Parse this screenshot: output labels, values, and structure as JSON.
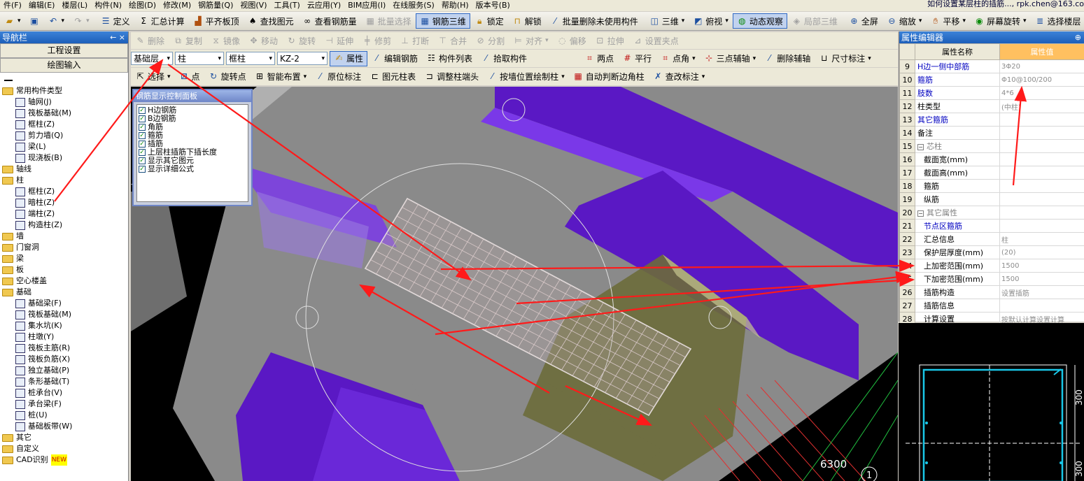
{
  "menu": {
    "items": [
      "件(F)",
      "编辑(E)",
      "楼层(L)",
      "构件(N)",
      "绘图(D)",
      "修改(M)",
      "钢筋量(Q)",
      "视图(V)",
      "工具(T)",
      "云应用(Y)",
      "BIM应用(I)",
      "在线服务(S)",
      "帮助(H)",
      "版本号(B)"
    ],
    "title_note": "如何设置某层柱的插筋..., rpk.chen@163.co"
  },
  "toolbar1": {
    "define": "定义",
    "sum": "汇总计算",
    "flat_top": "平齐板顶",
    "find": "查找图元",
    "view_rebar": "查看钢筋量",
    "batch_select": "批量选择",
    "rebar3d": "钢筋三维",
    "lock": "锁定",
    "unlock": "解锁",
    "batch_delete": "批量删除未使用构件",
    "view3d": "三维",
    "top_view": "俯视",
    "dynamic": "动态观察",
    "local3d": "局部三维",
    "fullscreen": "全屏",
    "zoom": "缩放",
    "pan": "平移",
    "rotate": "屏幕旋转",
    "select_floor": "选择楼层"
  },
  "draw_toolbar": {
    "delete": "删除",
    "copy": "复制",
    "mirror": "镜像",
    "move": "移动",
    "rotate": "旋转",
    "extend": "延伸",
    "trim": "修剪",
    "break": "打断",
    "merge": "合并",
    "split": "分割",
    "align": "对齐",
    "offset": "偏移",
    "stretch": "拉伸",
    "set_pin": "设置夹点"
  },
  "toolbar2": {
    "floor": "基础层",
    "type": "柱",
    "subtype": "框柱",
    "component": "KZ-2",
    "properties": "属性",
    "edit_rebar": "编辑钢筋",
    "component_list": "构件列表",
    "pick": "拾取构件",
    "two_point": "两点",
    "parallel": "平行",
    "point_angle": "点角",
    "three_point_axis": "三点辅轴",
    "delete_axis": "删除辅轴",
    "dimension": "尺寸标注"
  },
  "toolbar3": {
    "select": "选择",
    "point": "点",
    "rotate_point": "旋转点",
    "smart_layout": "智能布置",
    "origin_label": "原位标注",
    "column_table": "图元柱表",
    "adjust_end": "调整柱端头",
    "wall_draw": "按墙位置绘制柱",
    "auto_corner": "自动判断边角柱",
    "check_label": "查改标注"
  },
  "nav": {
    "title": "导航栏",
    "pin": "← ×",
    "project_settings": "工程设置",
    "drawing_input": "绘图输入",
    "tree": [
      {
        "type": "folder",
        "label": "常用构件类型"
      },
      {
        "type": "leaf",
        "label": "轴网(J)"
      },
      {
        "type": "leaf",
        "label": "筏板基础(M)"
      },
      {
        "type": "leaf",
        "label": "框柱(Z)"
      },
      {
        "type": "leaf",
        "label": "剪力墙(Q)"
      },
      {
        "type": "leaf",
        "label": "梁(L)"
      },
      {
        "type": "leaf",
        "label": "现浇板(B)"
      },
      {
        "type": "folder",
        "label": "轴线"
      },
      {
        "type": "folder",
        "label": "柱"
      },
      {
        "type": "leaf",
        "label": "框柱(Z)"
      },
      {
        "type": "leaf",
        "label": "暗柱(Z)"
      },
      {
        "type": "leaf",
        "label": "端柱(Z)"
      },
      {
        "type": "leaf",
        "label": "构造柱(Z)"
      },
      {
        "type": "folder",
        "label": "墙"
      },
      {
        "type": "folder",
        "label": "门窗洞"
      },
      {
        "type": "folder",
        "label": "梁"
      },
      {
        "type": "folder",
        "label": "板"
      },
      {
        "type": "folder",
        "label": "空心楼盖"
      },
      {
        "type": "folder",
        "label": "基础"
      },
      {
        "type": "leaf",
        "label": "基础梁(F)"
      },
      {
        "type": "leaf",
        "label": "筏板基础(M)"
      },
      {
        "type": "leaf",
        "label": "集水坑(K)"
      },
      {
        "type": "leaf",
        "label": "柱墩(Y)"
      },
      {
        "type": "leaf",
        "label": "筏板主筋(R)"
      },
      {
        "type": "leaf",
        "label": "筏板负筋(X)"
      },
      {
        "type": "leaf",
        "label": "独立基础(P)"
      },
      {
        "type": "leaf",
        "label": "条形基础(T)"
      },
      {
        "type": "leaf",
        "label": "桩承台(V)"
      },
      {
        "type": "leaf",
        "label": "承台梁(F)"
      },
      {
        "type": "leaf",
        "label": "桩(U)"
      },
      {
        "type": "leaf",
        "label": "基础板带(W)"
      },
      {
        "type": "folder",
        "label": "其它"
      },
      {
        "type": "folder",
        "label": "自定义"
      },
      {
        "type": "folder",
        "label": "CAD识别"
      }
    ],
    "new_badge": "NEW"
  },
  "control_panel": {
    "title": "钢筋显示控制面板",
    "items": [
      "H边钢筋",
      "B边钢筋",
      "角筋",
      "箍筋",
      "插筋",
      "上层柱插筋下插长度",
      "显示其它图元",
      "显示详细公式"
    ]
  },
  "properties": {
    "title": "属性编辑器",
    "col_name": "属性名称",
    "col_value": "属性值",
    "rows": [
      {
        "n": "9",
        "name": "H边一侧中部筋",
        "val": "3Φ20",
        "blue": true
      },
      {
        "n": "10",
        "name": "箍筋",
        "val": "Φ10@100/200",
        "blue": true
      },
      {
        "n": "11",
        "name": "肢数",
        "val": "4*6",
        "blue": true
      },
      {
        "n": "12",
        "name": "柱类型",
        "val": "(中柱)"
      },
      {
        "n": "13",
        "name": "其它箍筋",
        "val": "",
        "blue": true
      },
      {
        "n": "14",
        "name": "备注",
        "val": ""
      },
      {
        "n": "15",
        "name": "芯柱",
        "val": "",
        "group": true
      },
      {
        "n": "16",
        "name": "截面宽(mm)",
        "val": "",
        "child": true
      },
      {
        "n": "17",
        "name": "截面高(mm)",
        "val": "",
        "child": true
      },
      {
        "n": "18",
        "name": "箍筋",
        "val": "",
        "child": true
      },
      {
        "n": "19",
        "name": "纵筋",
        "val": "",
        "child": true
      },
      {
        "n": "20",
        "name": "其它属性",
        "val": "",
        "group": true
      },
      {
        "n": "21",
        "name": "节点区箍筋",
        "val": "",
        "child": true,
        "blue": true
      },
      {
        "n": "22",
        "name": "汇总信息",
        "val": "柱",
        "child": true
      },
      {
        "n": "23",
        "name": "保护层厚度(mm)",
        "val": "(20)",
        "child": true
      },
      {
        "n": "24",
        "name": "上加密范围(mm)",
        "val": "1500",
        "child": true
      },
      {
        "n": "25",
        "name": "下加密范围(mm)",
        "val": "1500",
        "child": true
      },
      {
        "n": "26",
        "name": "插筋构造",
        "val": "设置插筋",
        "child": true
      },
      {
        "n": "27",
        "name": "插筋信息",
        "val": "",
        "child": true
      },
      {
        "n": "28",
        "name": "计算设置",
        "val": "按默认计算设置计算",
        "child": true
      }
    ]
  },
  "viewport": {
    "dimension_label": "6300",
    "axis_label": "1"
  },
  "section": {
    "dim_label": "300",
    "dim_label2": "300"
  },
  "colors": {
    "purple": "#6a1fd8",
    "annotation": "#ff1a1a",
    "nav_title": "#1c5fb9",
    "section_outline": "#19c7e8"
  }
}
